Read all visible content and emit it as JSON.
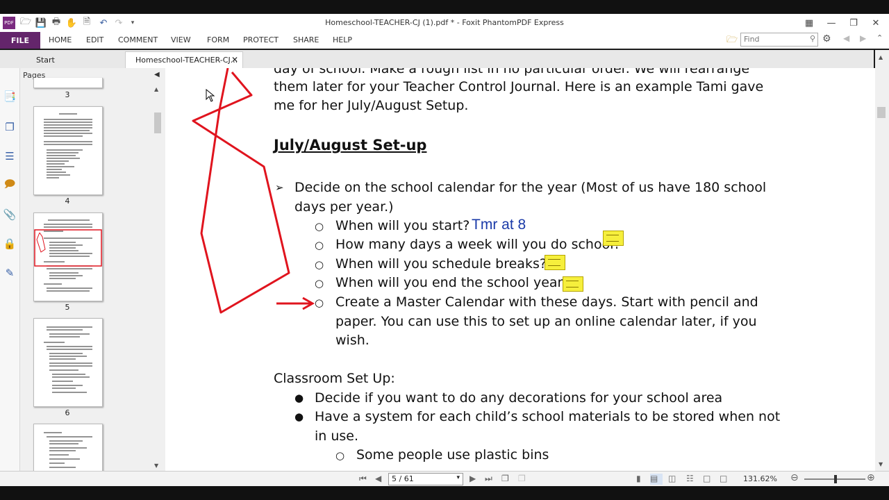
{
  "window": {
    "title": "Homeschool-TEACHER-CJ (1).pdf * - Foxit PhantomPDF Express"
  },
  "menu": {
    "file": "FILE",
    "items": [
      "HOME",
      "EDIT",
      "COMMENT",
      "VIEW",
      "FORM",
      "PROTECT",
      "SHARE",
      "HELP"
    ]
  },
  "search": {
    "placeholder": "Find"
  },
  "tabs": [
    {
      "label": "Start"
    },
    {
      "label": "Homeschool-TEACHER-CJ..."
    }
  ],
  "panel": {
    "title": "Pages",
    "page_numbers": [
      "3",
      "4",
      "5",
      "6"
    ]
  },
  "document": {
    "lines": [
      "day of school. Make a rough list in no particular order. We will rearrange",
      "them later for your Teacher Control Journal. Here is an example Tami gave",
      "me for her July/August Setup."
    ],
    "heading": "July/August Set-up",
    "item1": [
      "Decide on the school calendar for the year (Most of us have 180 school",
      "days per year.)"
    ],
    "sub": [
      "When will you start?",
      "How many days a week will you do school?",
      "When will you schedule breaks?",
      "When will you end the school year?",
      "Create a Master Calendar with these days. Start with pencil and",
      "paper. You can use this to set up an online calendar later, if you",
      "wish."
    ],
    "annotation": "Tmr at 8",
    "classroom_title": "Classroom Set Up:",
    "classroom": [
      "Decide if you want to do any decorations for your school area",
      "Have a system for each child’s school materials to be stored when not",
      "in use."
    ],
    "classroom_sub": [
      "Some people use plastic bins"
    ]
  },
  "status": {
    "page": "5 / 61",
    "zoom": "131.62%"
  },
  "colors": {
    "accent": "#64256b",
    "ink": "#e0141e",
    "note": "#f6ef3c",
    "annotation_text": "#1a3aa8"
  }
}
